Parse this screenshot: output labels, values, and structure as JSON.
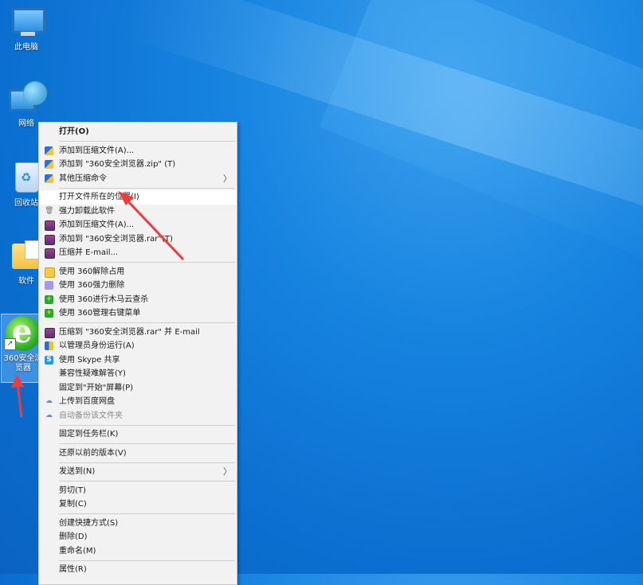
{
  "desktop": {
    "icons": [
      {
        "label": "此电脑"
      },
      {
        "label": "网络"
      },
      {
        "label": "回收站"
      },
      {
        "label": "软件"
      },
      {
        "label": "360安全浏览器"
      }
    ]
  },
  "context_menu": {
    "items": [
      {
        "label": "打开(O)"
      },
      {
        "label": "添加到压缩文件(A)..."
      },
      {
        "label": "添加到 \"360安全浏览器.zip\" (T)"
      },
      {
        "label": "其他压缩命令"
      },
      {
        "label": "打开文件所在的位置(I)"
      },
      {
        "label": "强力卸载此软件"
      },
      {
        "label": "添加到压缩文件(A)..."
      },
      {
        "label": "添加到 \"360安全浏览器.rar\"(T)"
      },
      {
        "label": "压缩并 E-mail..."
      },
      {
        "label": "使用 360解除占用"
      },
      {
        "label": "使用 360强力删除"
      },
      {
        "label": "使用 360进行木马云查杀"
      },
      {
        "label": "使用 360管理右键菜单"
      },
      {
        "label": "压缩到 \"360安全浏览器.rar\" 并 E-mail"
      },
      {
        "label": "以管理员身份运行(A)"
      },
      {
        "label": "使用 Skype 共享"
      },
      {
        "label": "兼容性疑难解答(Y)"
      },
      {
        "label": "固定到\"开始\"屏幕(P)"
      },
      {
        "label": "上传到百度网盘"
      },
      {
        "label": "自动备份该文件夹"
      },
      {
        "label": "固定到任务栏(K)"
      },
      {
        "label": "还原以前的版本(V)"
      },
      {
        "label": "发送到(N)"
      },
      {
        "label": "剪切(T)"
      },
      {
        "label": "复制(C)"
      },
      {
        "label": "创建快捷方式(S)"
      },
      {
        "label": "删除(D)"
      },
      {
        "label": "重命名(M)"
      },
      {
        "label": "属性(R)"
      }
    ],
    "submenu_glyph": "〉"
  },
  "icons": {
    "recycle": "♻",
    "uninstall": "🗑",
    "cloud": "☁",
    "green_360": "+",
    "skype": "S",
    "rar": "≡",
    "e_letter": "e",
    "shortcut": "↗"
  },
  "colors": {
    "desktop": "#1784e0",
    "menu_bg": "#f2f2f2",
    "annotation_arrow": "#ee3b3b"
  }
}
